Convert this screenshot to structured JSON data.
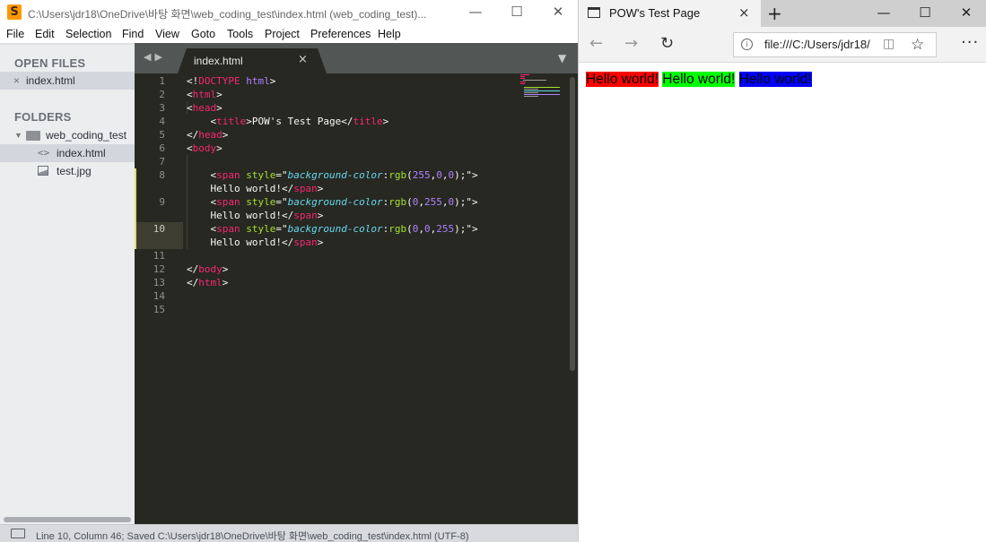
{
  "sublime": {
    "title": "C:\\Users\\jdr18\\OneDrive\\바탕 화면\\web_coding_test\\index.html (web_coding_test)...",
    "logo": "S",
    "menu": [
      "File",
      "Edit",
      "Selection",
      "Find",
      "View",
      "Goto",
      "Tools",
      "Project",
      "Preferences",
      "Help"
    ],
    "sidebar": {
      "open_files_header": "OPEN FILES",
      "open_files": [
        {
          "close": "×",
          "name": "index.html"
        }
      ],
      "folders_header": "FOLDERS",
      "folder": {
        "name": "web_coding_test"
      },
      "files": [
        {
          "icon": "code-file-icon",
          "glyph": "<>",
          "name": "index.html"
        },
        {
          "icon": "image-file-icon",
          "name": "test.jpg"
        }
      ]
    },
    "tab": {
      "label": "index.html",
      "close": "×"
    },
    "status_text": "Line 10, Column 46; Saved C:\\Users\\jdr18\\OneDrive\\바탕 화면\\web_coding_test\\index.html (UTF-8)",
    "line_numbers": [
      "1",
      "2",
      "3",
      "4",
      "5",
      "6",
      "7",
      "8",
      "9",
      "10",
      "11",
      "12",
      "13",
      "14",
      "15"
    ],
    "code": {
      "l1_lt": "<!",
      "l1_doctype": "DOCTYPE",
      "l1_html": "html",
      "l1_gt": ">",
      "html_open": "html",
      "head_open": "head",
      "l4_title": "title",
      "l4_text": "POW's Test Page",
      "l4_title_close": "title",
      "head_close": "head",
      "body_open": "body",
      "span": "span",
      "style": "style",
      "eq_quote": "=\"",
      "bgprop": "background-color",
      "colon": ":",
      "rgb": "rgb",
      "paren_open": "(",
      "paren_close": ")",
      "semi_quote": ";\"",
      "l8_nums": [
        "255",
        "0",
        "0"
      ],
      "l9_nums": [
        "0",
        "255",
        "0"
      ],
      "l10_nums": [
        "0",
        "0",
        "255"
      ],
      "comma": ",",
      "hello": "Hello world!",
      "body_close": "body",
      "html_close": "html"
    },
    "colors": {
      "editor_bg": "#272822",
      "tag": "#f92672",
      "attr": "#a6e22e",
      "string": "#e6db74",
      "value": "#66d9ef",
      "number": "#ae81ff"
    }
  },
  "edge": {
    "tab_title": "POW's Test Page",
    "tab_close": "×",
    "new_tab": "+",
    "address": "file:///C:/Users/jdr18/",
    "more": "···",
    "page_spans": [
      {
        "text": "Hello world!",
        "bg": "#ff0000"
      },
      {
        "text": "Hello world!",
        "bg": "#00ff00"
      },
      {
        "text": "Hello world!",
        "bg": "#0000ff"
      }
    ]
  }
}
